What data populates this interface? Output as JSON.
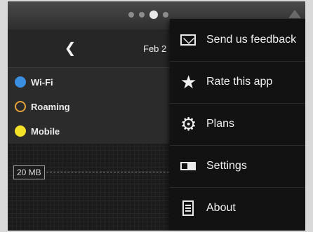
{
  "nav": {
    "date_label": "Feb 2",
    "back_icon": "chevron-left-icon",
    "menu_icon": "overflow-icon"
  },
  "legend": [
    {
      "label": "Wi-Fi",
      "color": "#3a8fe0",
      "style": "filled"
    },
    {
      "label": "Roaming",
      "color": "#e4a33a",
      "style": "outline"
    },
    {
      "label": "Mobile",
      "color": "#f3e227",
      "style": "filled"
    }
  ],
  "chart": {
    "limit_label": "20 MB"
  },
  "menu": {
    "items": [
      {
        "label": "Send us feedback",
        "icon": "envelope-icon"
      },
      {
        "label": "Rate this app",
        "icon": "star-icon"
      },
      {
        "label": "Plans",
        "icon": "gear-icon"
      },
      {
        "label": "Settings",
        "icon": "toggle-icon"
      },
      {
        "label": "About",
        "icon": "document-icon"
      }
    ]
  }
}
